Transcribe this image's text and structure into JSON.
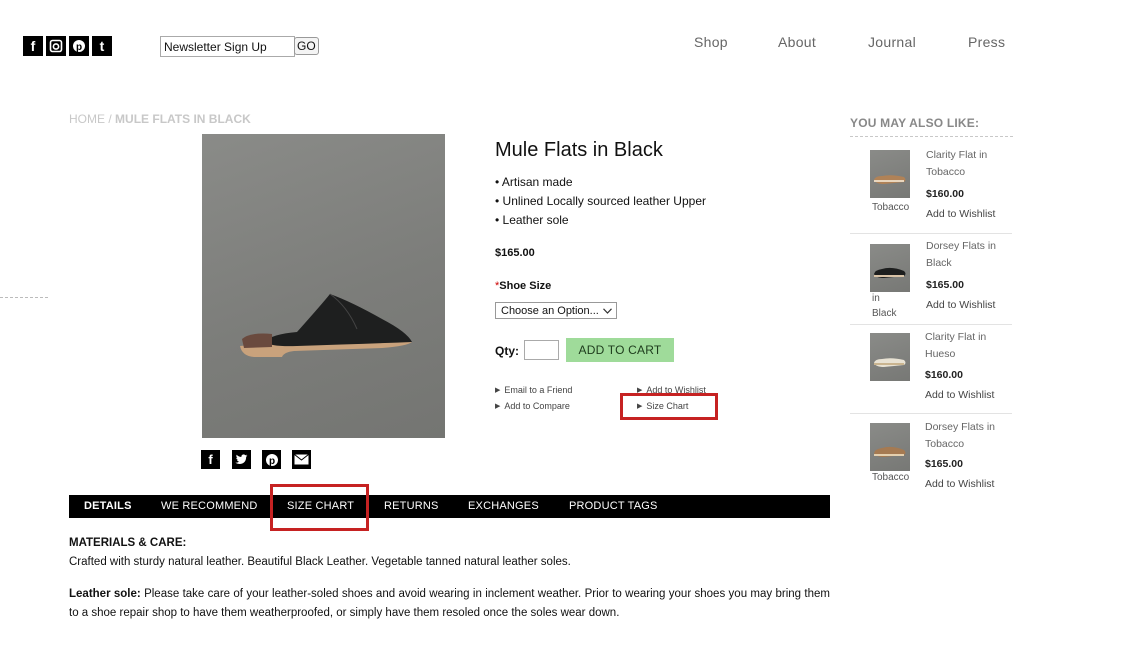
{
  "social_icons": [
    "facebook-icon",
    "instagram-icon",
    "pinterest-icon",
    "tumblr-icon"
  ],
  "newsletter": {
    "placeholder": "Newsletter Sign Up",
    "value": "Newsletter Sign Up",
    "button": "GO"
  },
  "nav": [
    "Shop",
    "About",
    "Journal",
    "Press"
  ],
  "breadcrumb": {
    "home": "HOME",
    "sep": "/",
    "current": "MULE FLATS IN BLACK"
  },
  "product": {
    "title": "Mule Flats in Black",
    "features": [
      "• Artisan made",
      "• Unlined Locally sourced leather Upper",
      "• Leather sole"
    ],
    "price": "$165.00",
    "size_required": "*",
    "size_label": "Shoe Size",
    "size_select": "Choose an Option...",
    "qty_label": "Qty:",
    "qty_value": "",
    "add_to_cart": "ADD TO CART",
    "links": {
      "email": "Email to a Friend",
      "wishlist": "Add to Wishlist",
      "compare": "Add to Compare",
      "size_chart": "Size Chart"
    }
  },
  "share_icons": [
    "facebook-icon",
    "twitter-icon",
    "pinterest-icon",
    "email-icon"
  ],
  "tabs": [
    "DETAILS",
    "WE RECOMMEND",
    "SIZE CHART",
    "RETURNS",
    "EXCHANGES",
    "PRODUCT TAGS"
  ],
  "details": {
    "materials_heading": "MATERIALS & CARE:",
    "materials_text": "Crafted with sturdy natural leather. Beautiful Black Leather. Vegetable tanned natural leather soles.",
    "sole_label": "Leather sole:",
    "sole_text": " Please take care of your leather-soled shoes and avoid wearing in inclement weather. Prior to wearing your shoes you may bring them to a shoe repair shop to have them weatherproofed, or simply have them resoled once the soles wear down."
  },
  "sidebar": {
    "heading": "YOU MAY ALSO LIKE:",
    "items": [
      {
        "name_line1": "Clarity Flat in",
        "name_line2": "Tobacco",
        "price": "$160.00",
        "wishlist": "Add to Wishlist",
        "caption1": "Tobacco",
        "caption2": ""
      },
      {
        "name_line1": "Dorsey Flats in",
        "name_line2": "Black",
        "price": "$165.00",
        "wishlist": "Add to Wishlist",
        "caption1": "in",
        "caption2": "Black"
      },
      {
        "name_line1": "Clarity Flat in",
        "name_line2": "Hueso",
        "price": "$160.00",
        "wishlist": "Add to Wishlist",
        "caption1": "",
        "caption2": ""
      },
      {
        "name_line1": "Dorsey Flats in",
        "name_line2": "Tobacco",
        "price": "$165.00",
        "wishlist": "Add to Wishlist",
        "caption1": "Tobacco",
        "caption2": ""
      }
    ]
  },
  "colors": {
    "accent_green": "#9fdb9a",
    "highlight_red": "#c62222",
    "tab_bar": "#000000"
  }
}
